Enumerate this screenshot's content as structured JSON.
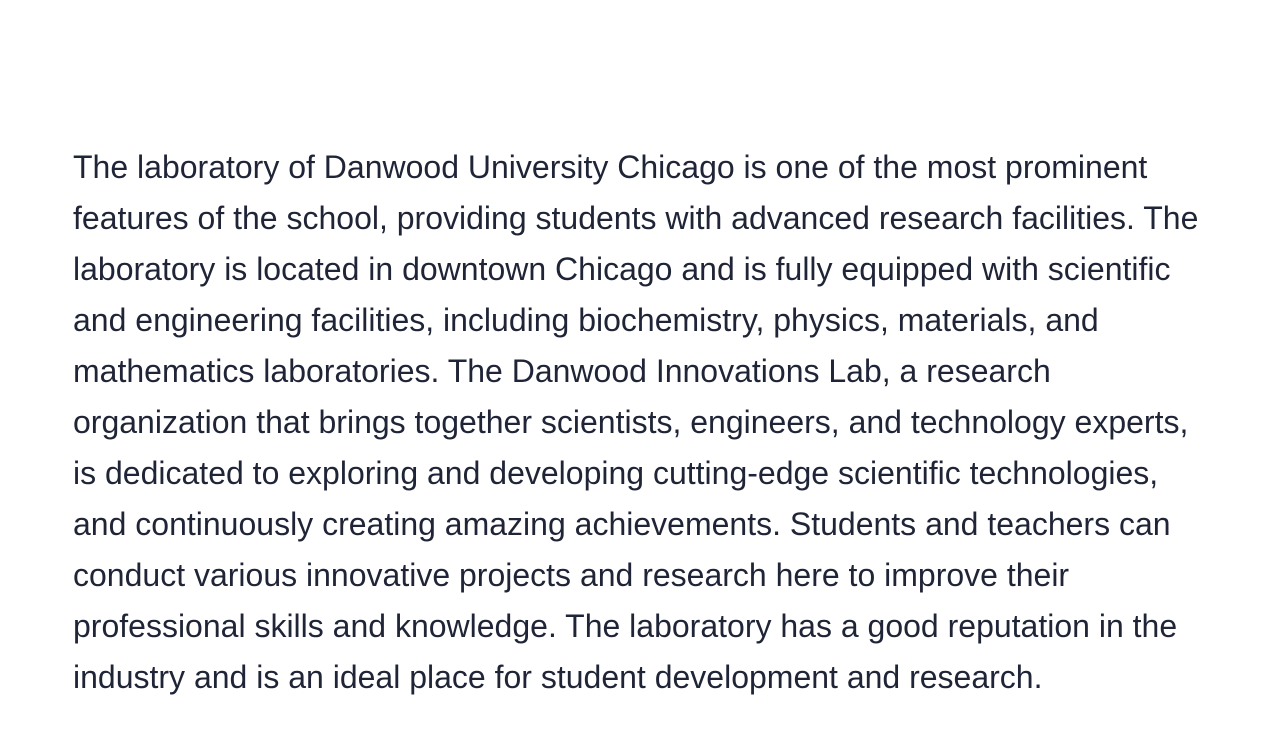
{
  "article": {
    "body": "The laboratory of Danwood University Chicago is one of the most prominent features of the school, providing students with advanced research facilities. The laboratory is located in downtown Chicago and is fully equipped with scientific and engineering facilities, including biochemistry, physics, materials, and mathematics laboratories. The Danwood Innovations Lab, a research organization that brings together scientists, engineers, and technology experts, is dedicated to exploring and developing cutting-edge scientific technologies, and continuously creating amazing achievements. Students and teachers can conduct various innovative projects and research here to improve their professional skills and knowledge. The laboratory has a good reputation in the industry and is an ideal place for student development and research."
  },
  "colors": {
    "text": "#1f2437",
    "background": "#ffffff"
  }
}
